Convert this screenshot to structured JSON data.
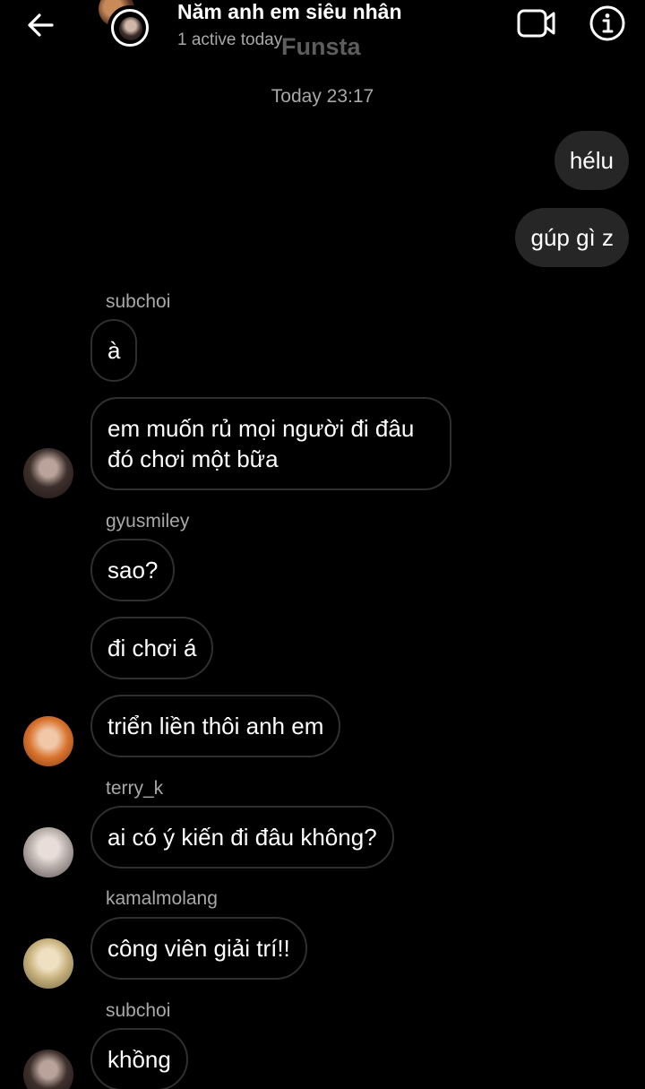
{
  "header": {
    "title": "Năm anh em siêu nhân",
    "status": "1 active today",
    "watermark": "Funsta"
  },
  "timestamp": "Today 23:17",
  "messages": {
    "m1": "hélu",
    "m2": "gúp gì z",
    "m3": "à",
    "m4": "em muốn rủ mọi người đi đâu đó chơi một bữa",
    "m5": "sao?",
    "m6": "đi chơi á",
    "m7": "triển liền thôi anh em",
    "m8": "ai có ý kiến đi đâu không?",
    "m9": "công viên giải trí!!",
    "m10": "khồng"
  },
  "senders": {
    "s1": "subchoi",
    "s2": "gyusmiley",
    "s3": "terry_k",
    "s4": "kamalmolang",
    "s5": "subchoi"
  },
  "icons": {
    "back": "arrow-left-icon",
    "video": "video-camera-icon",
    "info": "info-icon"
  },
  "colors": {
    "background": "#000000",
    "outgoing_bubble": "#262626",
    "incoming_border": "#2f2f2f",
    "secondary_text": "#a8a8a8"
  }
}
